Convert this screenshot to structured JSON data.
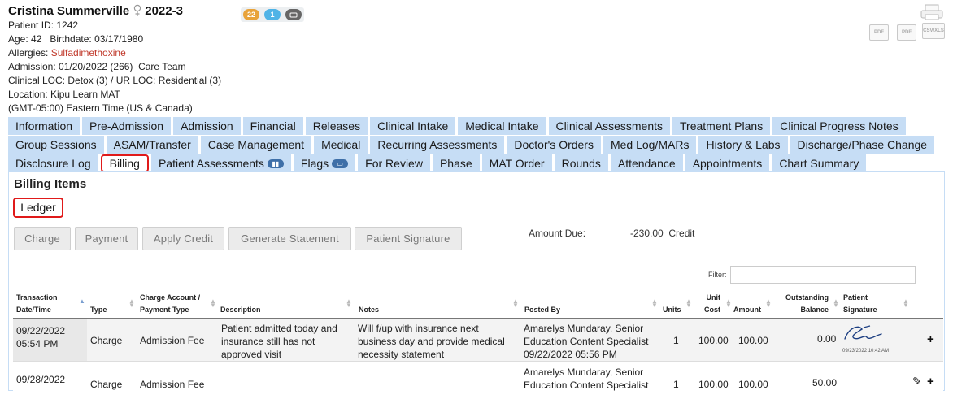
{
  "patient": {
    "name": "Cristina Summerville",
    "episode": "2022-3",
    "patient_id": "Patient ID: 1242",
    "age_birth": "Age: 42   Birthdate: 03/17/1980",
    "allergies_label": "Allergies: ",
    "allergies_value": "Sulfadimethoxine",
    "admission": "Admission: 01/20/2022 (266)  Care Team",
    "loc": "Clinical LOC: Detox (3) / UR LOC: Residential (3)",
    "location": "Location: Kipu Learn MAT",
    "timezone": "(GMT-05:00) Eastern Time (US & Canada)"
  },
  "badges": {
    "count_orange": "22",
    "count_blue": "1"
  },
  "exports": {
    "pdf": "PDF",
    "pdf2": "PDF",
    "csv": "CSV/XLS"
  },
  "tabs": {
    "row1": [
      "Information",
      "Pre-Admission",
      "Admission",
      "Financial",
      "Releases",
      "Clinical Intake",
      "Medical Intake",
      "Clinical Assessments",
      "Treatment Plans",
      "Clinical Progress Notes"
    ],
    "row2": [
      "Group Sessions",
      "ASAM/Transfer",
      "Case Management",
      "Medical",
      "Recurring Assessments",
      "Doctor's Orders",
      "Med Log/MARs",
      "History & Labs",
      "Discharge/Phase Change"
    ],
    "row3": [
      "Disclosure Log",
      "Billing",
      "Patient Assessments",
      "Flags",
      "For Review",
      "Phase",
      "MAT Order",
      "Rounds",
      "Attendance",
      "Appointments",
      "Chart Summary"
    ]
  },
  "billing": {
    "title": "Billing Items",
    "ledger": "Ledger",
    "buttons": [
      "Charge",
      "Payment",
      "Apply Credit",
      "Generate Statement",
      "Patient Signature"
    ],
    "amount_due_label": "Amount Due:",
    "amount_due_value": "-230.00  Credit",
    "filter_label": "Filter:",
    "filter_value": ""
  },
  "table": {
    "headers": {
      "date": [
        "Transaction",
        "Date/Time"
      ],
      "type": "Type",
      "account": [
        "Charge Account /",
        "Payment Type"
      ],
      "description": "Description",
      "notes": "Notes",
      "posted": "Posted By",
      "units": "Units",
      "unit_cost": [
        "Unit",
        "Cost"
      ],
      "amount": "Amount",
      "balance": [
        "Outstanding",
        "Balance"
      ],
      "signature": [
        "Patient",
        "Signature"
      ]
    },
    "rows": [
      {
        "date": [
          "09/22/2022",
          "05:54 PM"
        ],
        "type": "Charge",
        "account": "Admission Fee",
        "description": [
          "Patient admitted today and",
          "insurance still has not",
          "approved visit"
        ],
        "notes": [
          "Will f/up with insurance next",
          "business day and provide medical",
          "necessity statement"
        ],
        "posted": [
          "Amarelys Mundaray, Senior",
          "Education Content Specialist",
          "09/22/2022 05:56 PM"
        ],
        "units": "1",
        "unit_cost": "100.00",
        "amount": "100.00",
        "balance": "0.00",
        "signature_time": "09/23/2022 10:42 AM"
      },
      {
        "date": [
          "09/28/2022",
          ""
        ],
        "type": "Charge",
        "account": "Admission Fee",
        "description": [
          "",
          "",
          ""
        ],
        "notes": [
          "",
          "",
          ""
        ],
        "posted": [
          "Amarelys Mundaray, Senior",
          "Education Content Specialist",
          ""
        ],
        "units": "1",
        "unit_cost": "100.00",
        "amount": "100.00",
        "balance": "50.00",
        "signature_time": ""
      }
    ]
  },
  "colors": {
    "tab_bg": "#c6ddf5",
    "active_outline": "#e01a1a",
    "allergy": "#c0392b"
  }
}
